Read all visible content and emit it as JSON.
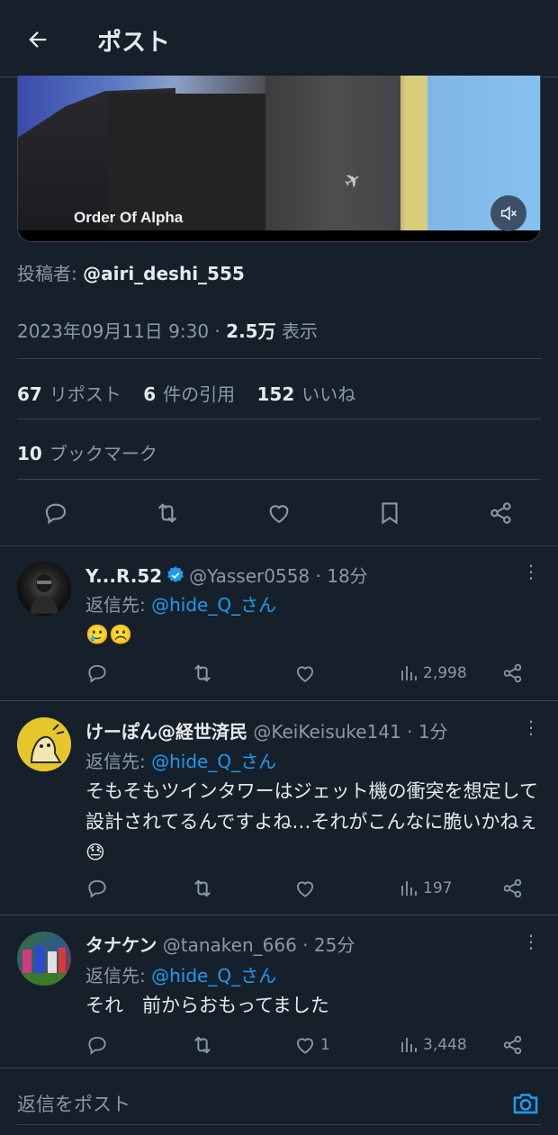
{
  "header": {
    "title": "ポスト",
    "back_icon": "arrow-left-icon"
  },
  "media": {
    "watermark": "Order Of Alpha",
    "mute_icon": "speaker-muted-icon"
  },
  "post": {
    "author_prefix": "投稿者: ",
    "author_handle": "@airi_deshi_555",
    "timestamp": "2023年09月11日 9:30",
    "separator": " · ",
    "views": "2.5万",
    "views_label": " 表示",
    "reposts_count": "67",
    "reposts_label": "リポスト",
    "quotes_count": "6",
    "quotes_label": "件の引用",
    "likes_count": "152",
    "likes_label": "いいね",
    "bookmarks_count": "10",
    "bookmarks_label": "ブックマーク"
  },
  "replies": [
    {
      "name": "Y...R.52",
      "verified": true,
      "handle": "@Yasser0558 · 18分",
      "replyto_prefix": "返信先: ",
      "replyto_link": "@hide_Q_さん",
      "text": "🥲☹️",
      "likes": "",
      "views": "2,998"
    },
    {
      "name": "けーぽん@経世済民",
      "verified": false,
      "handle": "@KeiKeisuke141 · 1分",
      "replyto_prefix": "返信先: ",
      "replyto_link": "@hide_Q_さん",
      "text": "そもそもツインタワーはジェット機の衝突を想定して設計されてるんですよね…それがこんなに脆いかねぇ😓",
      "likes": "",
      "views": "197"
    },
    {
      "name": "タナケン",
      "verified": false,
      "handle": "@tanaken_666 · 25分",
      "replyto_prefix": "返信先: ",
      "replyto_link": "@hide_Q_さん",
      "text": "それ　前からおもってました",
      "likes": "1",
      "views": "3,448"
    }
  ],
  "compose": {
    "placeholder": "返信をポスト",
    "camera_icon": "camera-icon"
  },
  "colors": {
    "background": "#15202b",
    "accent": "#1d9bf0",
    "muted": "#8b98a5",
    "text": "#e7e9ea",
    "border": "#38444d"
  }
}
